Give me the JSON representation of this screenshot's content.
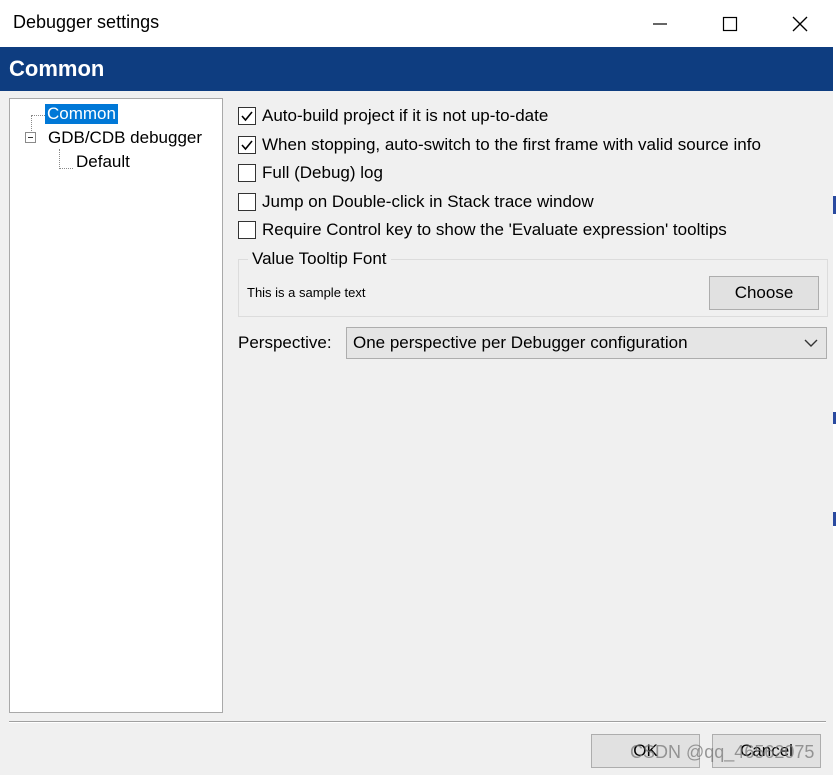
{
  "window": {
    "title": "Debugger settings",
    "buttons": [
      "minimize-icon",
      "maximize-icon",
      "close-icon"
    ]
  },
  "banner": {
    "title": "Common"
  },
  "tree": {
    "items": [
      {
        "label": "Common",
        "selected": true
      },
      {
        "label": "GDB/CDB debugger",
        "expanded": true
      },
      {
        "label": "Default"
      }
    ]
  },
  "options": {
    "auto_build": {
      "label": "Auto-build project if it is not up-to-date",
      "checked": true
    },
    "auto_switch": {
      "label": "When stopping, auto-switch to the first frame with valid source info",
      "checked": true
    },
    "full_log": {
      "label": "Full (Debug) log",
      "checked": false
    },
    "jump_dblclick": {
      "label": "Jump on Double-click in Stack trace window",
      "checked": false
    },
    "require_ctrl": {
      "label": "Require Control key to show the 'Evaluate expression' tooltips",
      "checked": false
    }
  },
  "font_group": {
    "title": "Value Tooltip Font",
    "sample": "This is a sample text",
    "choose_label": "Choose"
  },
  "perspective": {
    "label": "Perspective:",
    "value": "One perspective per Debugger configuration"
  },
  "footer": {
    "ok_label": "OK",
    "cancel_label": "Cancel",
    "watermark": "CSDN @qq_46562075"
  },
  "colors": {
    "banner": "#0e3d80",
    "selection": "#0078d7",
    "background": "#f0f0f0"
  }
}
